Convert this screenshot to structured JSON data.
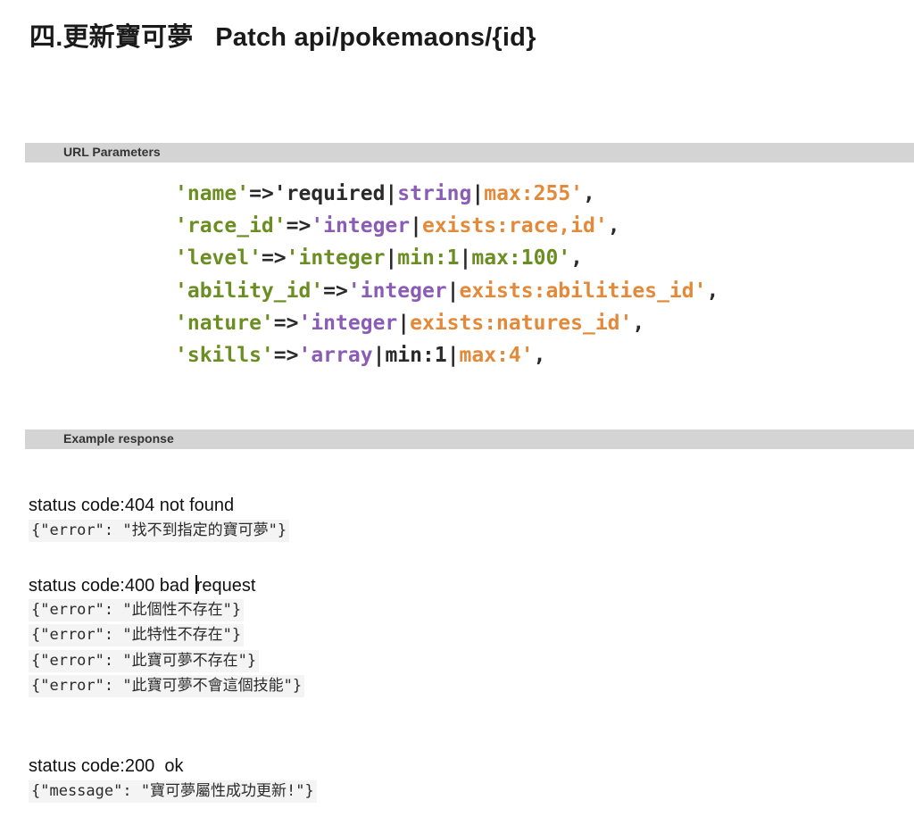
{
  "title": "四.更新寶可夢   Patch api/pokemaons/{id}",
  "sections": {
    "params_label": "URL Parameters",
    "response_label": "Example response"
  },
  "params": [
    [
      {
        "t": "'name'",
        "c": "g"
      },
      {
        "t": "=>",
        "c": "d"
      },
      {
        "t": "'required",
        "c": "d"
      },
      {
        "t": "|",
        "c": "d"
      },
      {
        "t": "string",
        "c": "p"
      },
      {
        "t": "|",
        "c": "d"
      },
      {
        "t": "max:255'",
        "c": "o"
      },
      {
        "t": ",",
        "c": "d"
      }
    ],
    [
      {
        "t": "'race_id'",
        "c": "g"
      },
      {
        "t": "=>",
        "c": "d"
      },
      {
        "t": "'integer",
        "c": "p"
      },
      {
        "t": "|",
        "c": "d"
      },
      {
        "t": "exists:race,id'",
        "c": "o"
      },
      {
        "t": ",",
        "c": "d"
      }
    ],
    [
      {
        "t": "'level'",
        "c": "g"
      },
      {
        "t": "=>",
        "c": "d"
      },
      {
        "t": "'integer",
        "c": "g"
      },
      {
        "t": "|",
        "c": "d"
      },
      {
        "t": "min:1",
        "c": "g"
      },
      {
        "t": "|",
        "c": "d"
      },
      {
        "t": "max:100'",
        "c": "g"
      },
      {
        "t": ",",
        "c": "d"
      }
    ],
    [
      {
        "t": "'ability_id'",
        "c": "g"
      },
      {
        "t": "=>",
        "c": "d"
      },
      {
        "t": "'integer",
        "c": "p"
      },
      {
        "t": "|",
        "c": "d"
      },
      {
        "t": "exists:abilities_id'",
        "c": "o"
      },
      {
        "t": ",",
        "c": "d"
      }
    ],
    [
      {
        "t": "'nature'",
        "c": "g"
      },
      {
        "t": "=>",
        "c": "d"
      },
      {
        "t": "'integer",
        "c": "p"
      },
      {
        "t": "|",
        "c": "d"
      },
      {
        "t": "exists:natures_id'",
        "c": "o"
      },
      {
        "t": ",",
        "c": "d"
      }
    ],
    [
      {
        "t": "'skills'",
        "c": "g"
      },
      {
        "t": "=>",
        "c": "d"
      },
      {
        "t": "'array",
        "c": "p"
      },
      {
        "t": "|",
        "c": "d"
      },
      {
        "t": "min:1",
        "c": "d"
      },
      {
        "t": "|",
        "c": "d"
      },
      {
        "t": "max:4'",
        "c": "o"
      },
      {
        "t": ",",
        "c": "d"
      }
    ]
  ],
  "colors": {
    "g": "#6b8e23",
    "p": "#8a5cb5",
    "o": "#e38a3a",
    "d": "#2a2a2a"
  },
  "responses": {
    "r404": {
      "status": "status code:404 not found",
      "bodies": [
        "{\"error\": \"找不到指定的寶可夢\"}"
      ]
    },
    "r400": {
      "status_a": "status code:400 bad ",
      "status_b": "request",
      "bodies": [
        "{\"error\": \"此個性不存在\"}",
        "{\"error\": \"此特性不存在\"}",
        "{\"error\": \"此寶可夢不存在\"}",
        "{\"error\": \"此寶可夢不會這個技能\"}"
      ]
    },
    "r200": {
      "status": "status code:200  ok",
      "bodies": [
        "{\"message\": \"寶可夢屬性成功更新!\"}"
      ]
    }
  }
}
